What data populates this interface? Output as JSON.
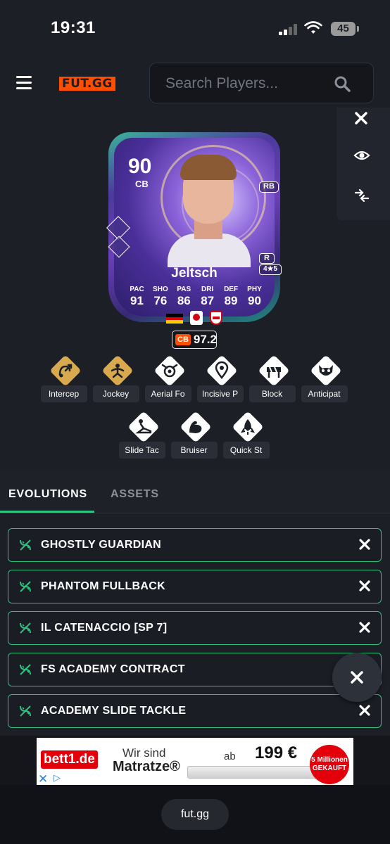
{
  "status": {
    "time": "19:31",
    "battery": "45"
  },
  "header": {
    "logo": "FUT.GG",
    "search_placeholder": "Search Players..."
  },
  "card": {
    "rating": "90",
    "position": "CB",
    "alt_position": "RB",
    "foot": "R",
    "skill_moves": "4★5",
    "name": "Jeltsch",
    "stat_labels": [
      "PAC",
      "SHO",
      "PAS",
      "DRI",
      "DEF",
      "PHY"
    ],
    "stat_values": [
      "91",
      "76",
      "86",
      "87",
      "89",
      "90"
    ],
    "meta_position": "CB",
    "meta_rating": "97.2"
  },
  "playstyles": [
    {
      "label": "Intercep",
      "icon": "intercept-icon",
      "plus": true
    },
    {
      "label": "Jockey",
      "icon": "jockey-icon",
      "plus": true
    },
    {
      "label": "Aerial Fo",
      "icon": "aerial-icon",
      "plus": false
    },
    {
      "label": "Incisive P",
      "icon": "incisive-pass-icon",
      "plus": false
    },
    {
      "label": "Block",
      "icon": "block-icon",
      "plus": false
    },
    {
      "label": "Anticipat",
      "icon": "anticipate-icon",
      "plus": false
    },
    {
      "label": "Slide Tac",
      "icon": "slide-tackle-icon",
      "plus": false
    },
    {
      "label": "Bruiser",
      "icon": "bruiser-icon",
      "plus": false
    },
    {
      "label": "Quick St",
      "icon": "quick-step-icon",
      "plus": false
    }
  ],
  "tabs": {
    "evolutions": "EVOLUTIONS",
    "assets": "ASSETS"
  },
  "evolutions": [
    "GHOSTLY GUARDIAN",
    "PHANTOM FULLBACK",
    "IL CATENACCIO [SP 7]",
    "FS ACADEMY CONTRACT",
    "ACADEMY SLIDE TACKLE"
  ],
  "ad": {
    "brand": "bett1.de",
    "line1": "Wir sind",
    "line2": "Matratze®",
    "price_prefix": "ab",
    "price": "199 €",
    "badge": "5 Millionen GEKAUFT"
  },
  "bottom": {
    "url": "fut.gg"
  },
  "colors": {
    "accent": "#2ec27e",
    "brand": "#ff4e00",
    "gold": "#d8a94f"
  }
}
